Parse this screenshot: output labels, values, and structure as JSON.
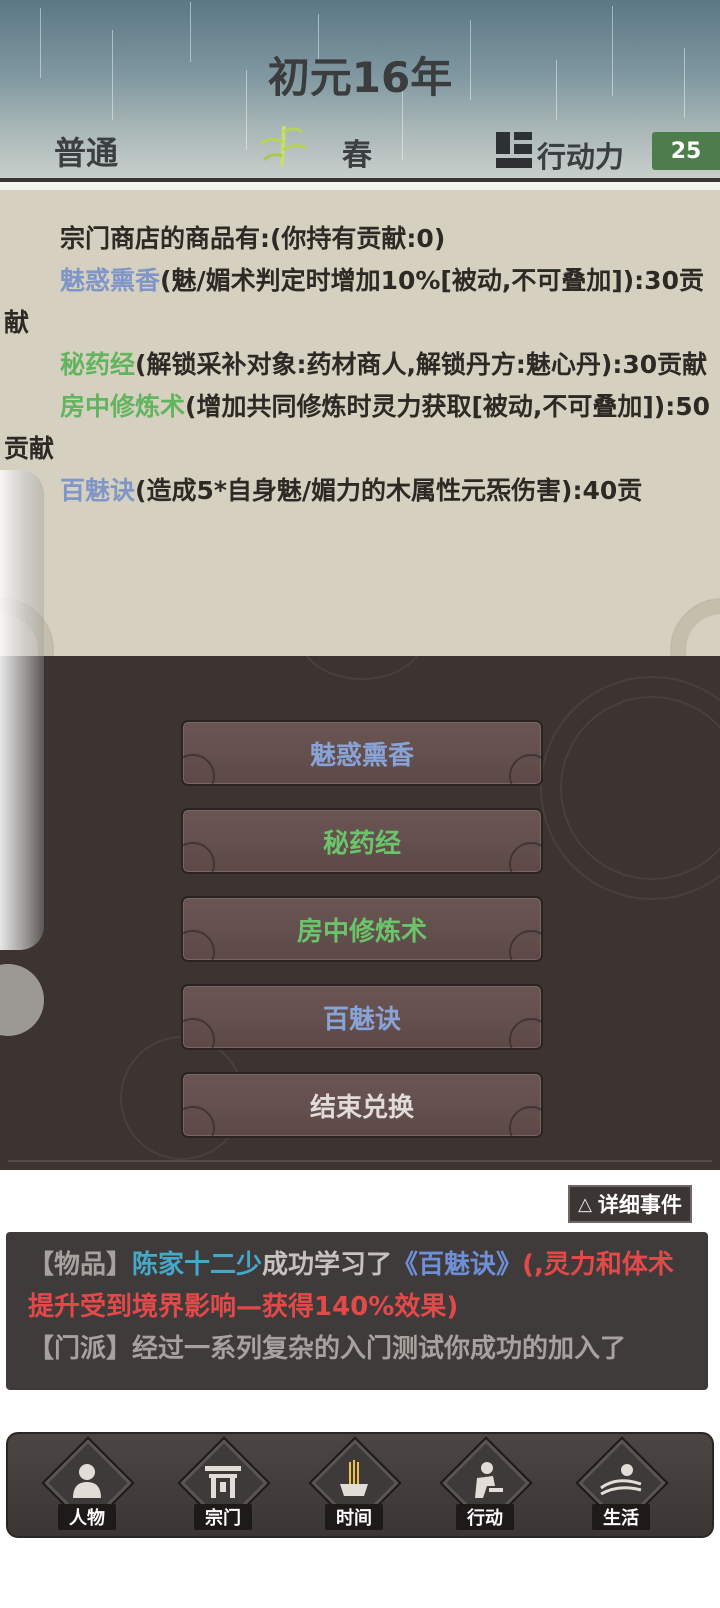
{
  "header": {
    "year": "初元16年",
    "difficulty": "普通",
    "season": "春",
    "action_points_label": "行动力",
    "action_points": "25"
  },
  "shop": {
    "intro": "宗门商店的商品有:(你持有贡献:0)",
    "items": [
      {
        "name": "魅惑熏香",
        "desc": "(魅/媚术判定时增加10%[被动,不可叠加]):30贡献",
        "color": "#7f96c7"
      },
      {
        "name": "秘药经",
        "desc": "(解锁采补对象:药材商人,解锁丹方:魅心丹):30贡献",
        "color": "#62b55e"
      },
      {
        "name": "房中修炼术",
        "desc": "(增加共同修炼时灵力获取[被动,不可叠加]):50贡献",
        "color": "#62b55e"
      },
      {
        "name": "百魅诀",
        "desc": "(造成5*自身魅/媚力的木属性元炁伤害):40贡",
        "color": "#7f96c7"
      }
    ]
  },
  "buttons": [
    {
      "label": "魅惑熏香",
      "color": "#8aa3d6"
    },
    {
      "label": "秘药经",
      "color": "#6cc46a"
    },
    {
      "label": "房中修炼术",
      "color": "#6cc46a"
    },
    {
      "label": "百魅诀",
      "color": "#8aa3d6"
    },
    {
      "label": "结束兑换",
      "color": "#e2dcd8"
    }
  ],
  "detail_button": {
    "icon": "triangle-icon",
    "label": "详细事件"
  },
  "log": {
    "line1": {
      "tag": "【物品】",
      "name": "陈家十二少",
      "text1": "成功学习了",
      "book": "《百魅诀》",
      "effect": "(,灵力和体术提升受到境界影响—获得140%效果)"
    },
    "line2": {
      "tag": "【门派】",
      "text": "经过一系列复杂的入门测试你成功的加入了"
    }
  },
  "nav": [
    {
      "label": "人物",
      "icon": "person-icon"
    },
    {
      "label": "宗门",
      "icon": "sect-gate-icon"
    },
    {
      "label": "时间",
      "icon": "incense-icon"
    },
    {
      "label": "行动",
      "icon": "action-icon"
    },
    {
      "label": "生活",
      "icon": "landscape-icon"
    }
  ]
}
